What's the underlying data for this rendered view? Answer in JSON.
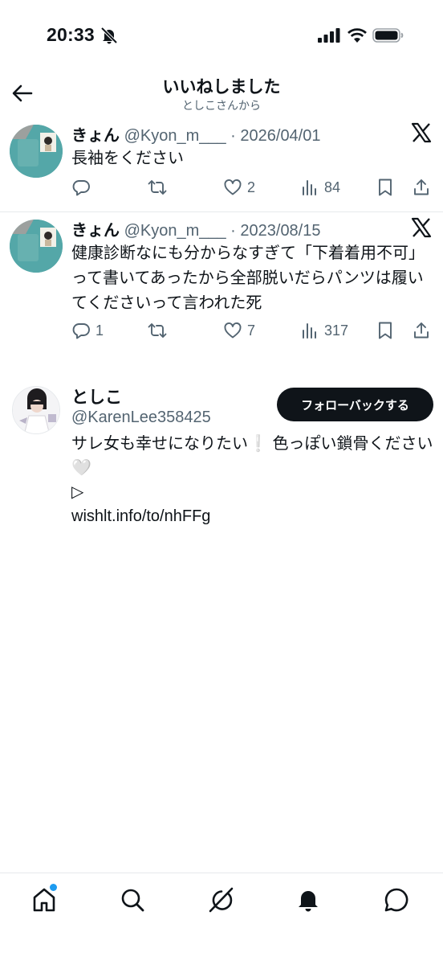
{
  "status_bar": {
    "time": "20:33"
  },
  "header": {
    "title": "いいねしました",
    "subtitle": "としこさんから"
  },
  "tweets": [
    {
      "name": "きょん",
      "handle": "@Kyon_m___",
      "date": "· 2026/04/01",
      "text": "長袖をください",
      "replies": "",
      "likes": "2",
      "views": "84"
    },
    {
      "name": "きょん",
      "handle": "@Kyon_m___",
      "date": "· 2023/08/15",
      "text": "健康診断なにも分からなすぎて「下着着用不可」って書いてあったから全部脱いだらパンツは履いてくださいって言われた死",
      "replies": "1",
      "likes": "7",
      "views": "317"
    }
  ],
  "user_card": {
    "name": "としこ",
    "handle": "@KarenLee358425",
    "follow_label": "フォローバックする",
    "bio_line1": "サレ女も幸せになりたい❕ 色っぽい鎖骨ください🤍",
    "bio_line2": "▷",
    "bio_line3": "wishlt.info/to/nhFFg"
  },
  "icons": {
    "back": "arrow-left-icon",
    "bell_off": "bell-slash-icon",
    "x_logo": "x-logo-icon",
    "reply": "reply-icon",
    "retweet": "retweet-icon",
    "like": "heart-icon",
    "views": "views-icon",
    "bookmark": "bookmark-icon",
    "share": "share-icon",
    "nav": [
      "home-icon",
      "search-icon",
      "grok-icon",
      "notifications-icon",
      "messages-icon"
    ]
  },
  "colors": {
    "accent": "#1d9bf0",
    "text": "#0f1419",
    "muted": "#536471"
  }
}
